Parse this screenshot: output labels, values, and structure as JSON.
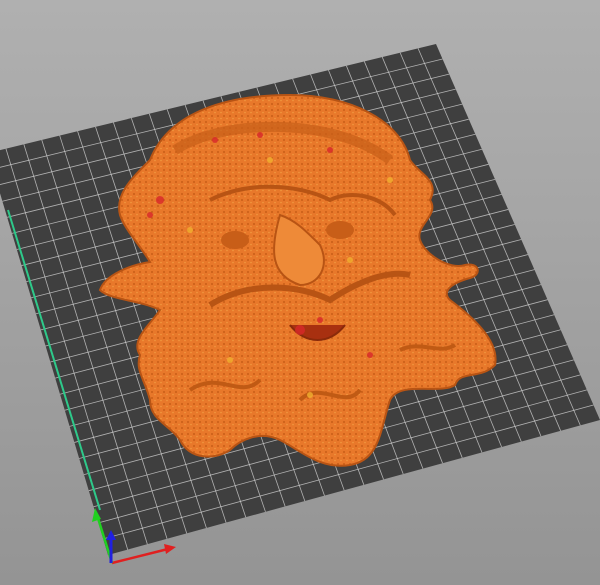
{
  "viewport": {
    "view": "3d-plater-view",
    "colors": {
      "background_top": "#b0b0b0",
      "background_bottom": "#949494",
      "bed": "#3f3f3f",
      "grid": "#d8d8d8",
      "model": "#e8782a",
      "model_shadow": "#b85414",
      "model_highlight": "#f0b030",
      "overhang": "#d8282a",
      "axis_x": "#e02020",
      "axis_y": "#20d020",
      "axis_z": "#2020e0"
    },
    "grid_divisions": 25,
    "icons": [
      "axis-gizmo-icon"
    ]
  }
}
